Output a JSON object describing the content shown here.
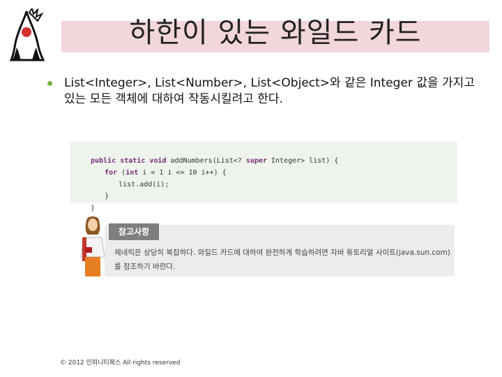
{
  "slide": {
    "title": "하한이 있는 와일드 카드",
    "bullet": "List<Integer>, List<Number>, List<Object>와 같은 Integer 값을 가지고 있는 모든 객체에 대하여 작동시킬려고 한다."
  },
  "code": {
    "lines": [
      {
        "kw": "public static void",
        "rest": " addNumbers(List<? ",
        "kw2": "super",
        "rest2": " Integer> list) {"
      },
      {
        "kw": "for",
        "rest": " (",
        "kw2": "int",
        "rest2": " i = 1 i <= 10 i++) {"
      },
      {
        "kw": "",
        "rest": "list.add(i);",
        "kw2": "",
        "rest2": ""
      },
      {
        "kw": "",
        "rest": "}",
        "kw2": "",
        "rest2": ""
      },
      {
        "kw": "",
        "rest": "}",
        "kw2": "",
        "rest2": ""
      }
    ]
  },
  "note": {
    "label": "참고사항",
    "text": "제네릭은 상당히 복잡하다. 와일드 카드에 대하여 완전하게 학습하려면 자바 튜토리얼 사이트(java.sun.com)를 참조하기 바란다."
  },
  "footer": {
    "text": "© 2012 인피니티북스 All rights reserved"
  },
  "colors": {
    "title_bar": "#f2d6d9",
    "bullet": "#7cb342",
    "code_bg": "#eef4ec",
    "keyword": "#7a2a7a",
    "note_label_bg": "#7f7f7f"
  },
  "icons": [
    "java-duke-logo-icon",
    "girl-illustration-icon"
  ]
}
